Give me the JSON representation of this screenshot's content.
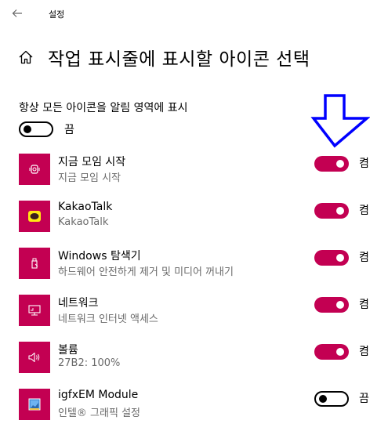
{
  "app": {
    "title": "설정"
  },
  "header": {
    "title": "작업 표시줄에 표시할 아이콘 선택"
  },
  "always_show": {
    "label": "항상 모든 아이콘을 알림 영역에 표시",
    "state": "끔",
    "on": false
  },
  "colors": {
    "accent": "#c30052",
    "arrow": "#0000ff"
  },
  "items": [
    {
      "name": "지금 모임 시작",
      "sub": "지금 모임 시작",
      "state": "켬",
      "on": true,
      "icon": "meet-now-icon"
    },
    {
      "name": "KakaoTalk",
      "sub": "KakaoTalk",
      "state": "켬",
      "on": true,
      "icon": "kakaotalk-icon"
    },
    {
      "name": "Windows 탐색기",
      "sub": "하드웨어 안전하게 제거 및 미디어 꺼내기",
      "state": "켬",
      "on": true,
      "icon": "usb-eject-icon"
    },
    {
      "name": "네트워크",
      "sub": "네트워크 인터넷 액세스",
      "state": "켬",
      "on": true,
      "icon": "network-icon"
    },
    {
      "name": "볼륨",
      "sub": "27B2: 100%",
      "state": "켬",
      "on": true,
      "icon": "volume-icon"
    },
    {
      "name": "igfxEM Module",
      "sub": "인텔® 그래픽 설정",
      "state": "끔",
      "on": false,
      "icon": "intel-graphics-icon"
    }
  ]
}
